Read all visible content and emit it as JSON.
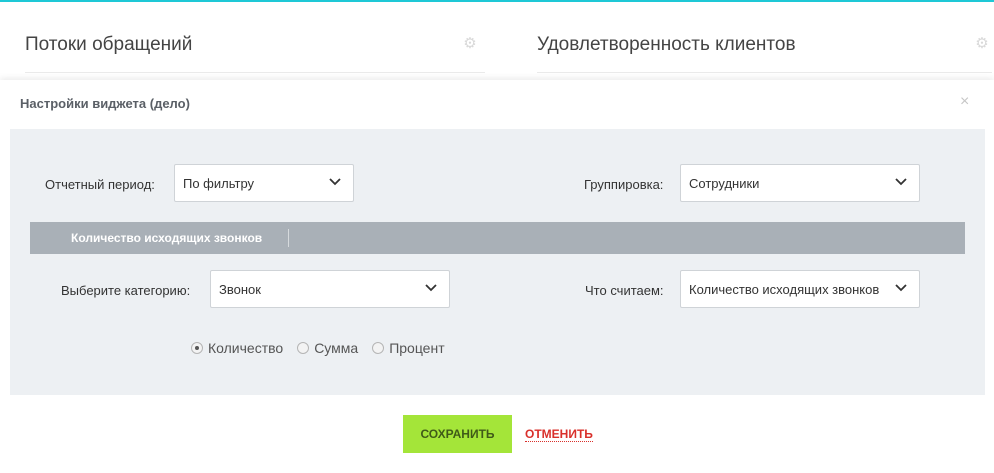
{
  "widgets": {
    "left_title": "Потоки обращений",
    "right_title": "Удовлетворенность клиентов"
  },
  "modal": {
    "title": "Настройки виджета (дело)",
    "close_glyph": "×",
    "period": {
      "label": "Отчетный период:",
      "value": "По фильтру"
    },
    "grouping": {
      "label": "Группировка:",
      "value": "Сотрудники"
    },
    "section": {
      "label": "Количество исходящих звонков"
    },
    "category": {
      "label": "Выберите категорию:",
      "value": "Звонок"
    },
    "metric": {
      "label": "Что считаем:",
      "value": "Количество исходящих звонков"
    },
    "aggregation": {
      "options": [
        "Количество",
        "Сумма",
        "Процент"
      ],
      "selected": "Количество"
    },
    "save_label": "СОХРАНИТЬ",
    "cancel_label": "ОТМЕНИТЬ"
  },
  "icons": {
    "gear": "gear-icon",
    "chevron": "chevron-down-icon",
    "close": "close-icon"
  },
  "colors": {
    "accent": "#1ec8d6",
    "save_button": "#a4e539",
    "cancel_link": "#d9302b",
    "section_bar": "#a9b0b7",
    "panel": "#edf0f3"
  }
}
